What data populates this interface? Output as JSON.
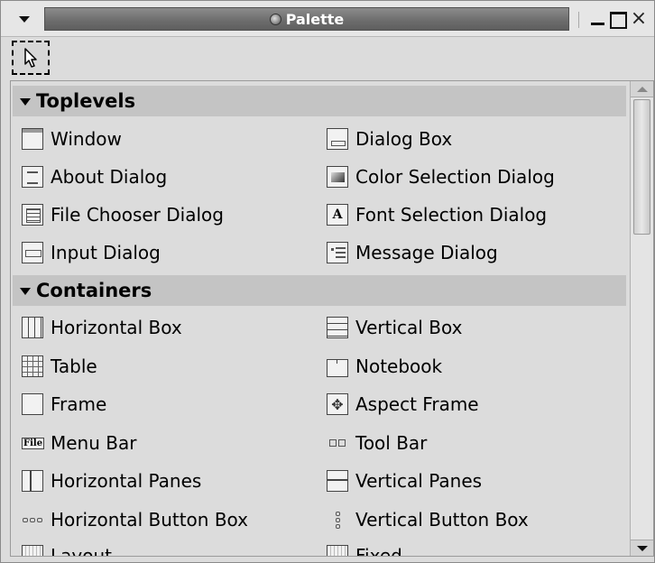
{
  "window": {
    "title": "Palette",
    "menu_icon": "triangle-down-icon",
    "controls": [
      "minimize-icon",
      "maximize-icon",
      "close-icon"
    ]
  },
  "toolbar": {
    "selector_icon": "pointer-arrow-icon"
  },
  "sections": [
    {
      "title": "Toplevels",
      "expanded": true,
      "items": [
        {
          "label": "Window",
          "icon": "window-icon"
        },
        {
          "label": "Dialog Box",
          "icon": "dialog-icon"
        },
        {
          "label": "About Dialog",
          "icon": "about-dialog-icon"
        },
        {
          "label": "Color Selection Dialog",
          "icon": "color-selection-icon"
        },
        {
          "label": "File Chooser Dialog",
          "icon": "file-chooser-icon"
        },
        {
          "label": "Font Selection Dialog",
          "icon": "font-selection-icon",
          "glyph": "A"
        },
        {
          "label": "Input Dialog",
          "icon": "input-dialog-icon"
        },
        {
          "label": "Message Dialog",
          "icon": "message-dialog-icon"
        }
      ]
    },
    {
      "title": "Containers",
      "expanded": true,
      "items": [
        {
          "label": "Horizontal Box",
          "icon": "hbox-icon"
        },
        {
          "label": "Vertical Box",
          "icon": "vbox-icon"
        },
        {
          "label": "Table",
          "icon": "table-icon"
        },
        {
          "label": "Notebook",
          "icon": "notebook-icon"
        },
        {
          "label": "Frame",
          "icon": "frame-icon"
        },
        {
          "label": "Aspect Frame",
          "icon": "aspect-frame-icon",
          "glyph": "✥"
        },
        {
          "label": "Menu Bar",
          "icon": "menu-bar-icon",
          "glyph": "File"
        },
        {
          "label": "Tool Bar",
          "icon": "tool-bar-icon"
        },
        {
          "label": "Horizontal Panes",
          "icon": "hpanes-icon"
        },
        {
          "label": "Vertical Panes",
          "icon": "vpanes-icon"
        },
        {
          "label": "Horizontal Button Box",
          "icon": "hbutton-box-icon"
        },
        {
          "label": "Vertical Button Box",
          "icon": "vbutton-box-icon"
        },
        {
          "label": "Layout",
          "icon": "layout-icon"
        },
        {
          "label": "Fixed",
          "icon": "fixed-icon"
        }
      ]
    }
  ]
}
